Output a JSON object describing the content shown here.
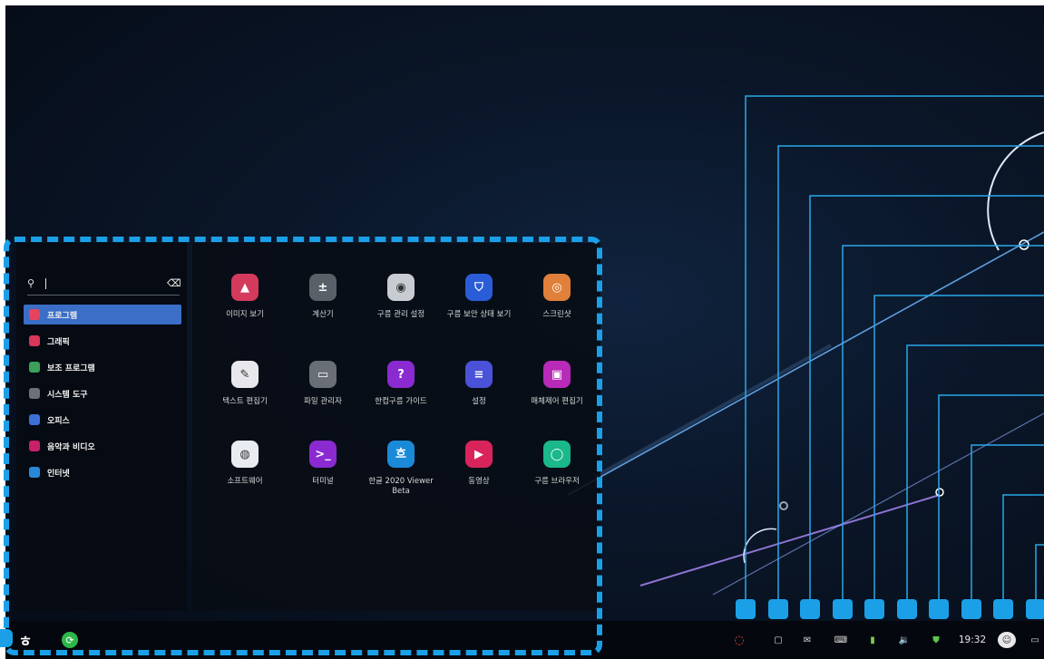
{
  "colors": {
    "accent": "#3b6ec6",
    "annotation": "#1ba0e8",
    "desktop_bg": "#0a1628"
  },
  "search": {
    "icon": "search-icon",
    "value": "",
    "clear_icon": "backspace-icon"
  },
  "categories": [
    {
      "label": "프로그램",
      "icon": "program-icon",
      "color": "#e8435c",
      "active": true
    },
    {
      "label": "그래픽",
      "icon": "graphics-icon",
      "color": "#d8365a",
      "active": false
    },
    {
      "label": "보조 프로그램",
      "icon": "accessory-icon",
      "color": "#3aa05a",
      "active": false
    },
    {
      "label": "시스템 도구",
      "icon": "system-tools-icon",
      "color": "#6c7078",
      "active": false
    },
    {
      "label": "오피스",
      "icon": "office-icon",
      "color": "#3d6fd8",
      "active": false
    },
    {
      "label": "음악과 비디오",
      "icon": "media-icon",
      "color": "#c8206a",
      "active": false
    },
    {
      "label": "인터넷",
      "icon": "internet-icon",
      "color": "#2a88d8",
      "active": false
    }
  ],
  "apps": [
    {
      "label": "이미지 보기",
      "icon": "image-viewer-icon",
      "color": "#d43a5c",
      "glyph": "▲"
    },
    {
      "label": "계산기",
      "icon": "calculator-icon",
      "color": "#5a6068",
      "glyph": "±"
    },
    {
      "label": "구름 관리 설정",
      "icon": "gooroom-management-icon",
      "color": "#c8ccd2",
      "glyph": "◉"
    },
    {
      "label": "구름 보안 상태 보기",
      "icon": "security-status-icon",
      "color": "#2a5cd8",
      "glyph": "⛉"
    },
    {
      "label": "스크린샷",
      "icon": "screenshot-icon",
      "color": "#e0803a",
      "glyph": "◎"
    },
    {
      "label": "텍스트 편집기",
      "icon": "text-editor-icon",
      "color": "#e8e8ec",
      "glyph": "✎"
    },
    {
      "label": "파일 관리자",
      "icon": "file-manager-icon",
      "color": "#6a6e76",
      "glyph": "▭"
    },
    {
      "label": "한컴구름 가이드",
      "icon": "guide-icon",
      "color": "#8a2ad0",
      "glyph": "?"
    },
    {
      "label": "설정",
      "icon": "settings-icon",
      "color": "#4a52d8",
      "glyph": "≡"
    },
    {
      "label": "매체제어 편집기",
      "icon": "media-control-icon",
      "color": "#b82ab8",
      "glyph": "▣"
    },
    {
      "label": "소프트웨어",
      "icon": "software-icon",
      "color": "#e8ecf0",
      "glyph": "◍"
    },
    {
      "label": "터미널",
      "icon": "terminal-icon",
      "color": "#8a2ad0",
      "glyph": ">_"
    },
    {
      "label": "한글 2020 Viewer Beta",
      "icon": "hangul-viewer-icon",
      "color": "#1a8ad8",
      "glyph": "흐"
    },
    {
      "label": "동영상",
      "icon": "video-icon",
      "color": "#d8245a",
      "glyph": "▶"
    },
    {
      "label": "구름 브라우저",
      "icon": "browser-icon",
      "color": "#1ab88a",
      "glyph": "◯"
    }
  ],
  "taskbar": {
    "start_icon": "gooroom-logo-icon",
    "update_icon": "update-icon",
    "tray": [
      "power-ring-icon",
      "window-icon",
      "mail-icon",
      "keyboard-icon",
      "battery-icon",
      "volume-icon",
      "shield-icon"
    ],
    "clock": "19:32",
    "user_icon": "avatar-icon",
    "desktop_icon": "show-desktop-icon"
  }
}
